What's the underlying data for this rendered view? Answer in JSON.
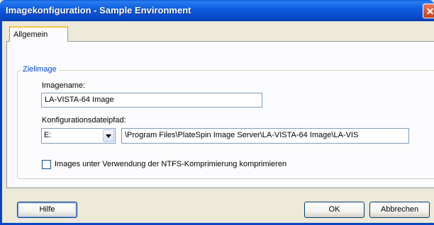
{
  "window": {
    "title": "Imagekonfiguration - Sample Environment",
    "close_glyph": "✕"
  },
  "tabs": [
    {
      "label": "Allgemein",
      "selected": true
    }
  ],
  "group": {
    "legend": "Zielimage",
    "image_name_label": "Imagename:",
    "image_name_value": "LA-VISTA-64 Image",
    "config_path_label": "Konfigurationsdateipfad:",
    "drive_value": "E:",
    "path_value": "\\Program Files\\PlateSpin Image Server\\LA-VISTA-64 Image\\LA-VIS",
    "ntfs_checkbox_label": "Images unter Verwendung der NTFS-Komprimierung komprimieren",
    "ntfs_checked": false
  },
  "buttons": {
    "help": "Hilfe",
    "ok": "OK",
    "cancel": "Abbrechen"
  },
  "colors": {
    "title_bar": "#0a5fd8",
    "accent_legend": "#0046d5",
    "tab_highlight": "#f5c445",
    "dialog_bg": "#ece9d8"
  }
}
